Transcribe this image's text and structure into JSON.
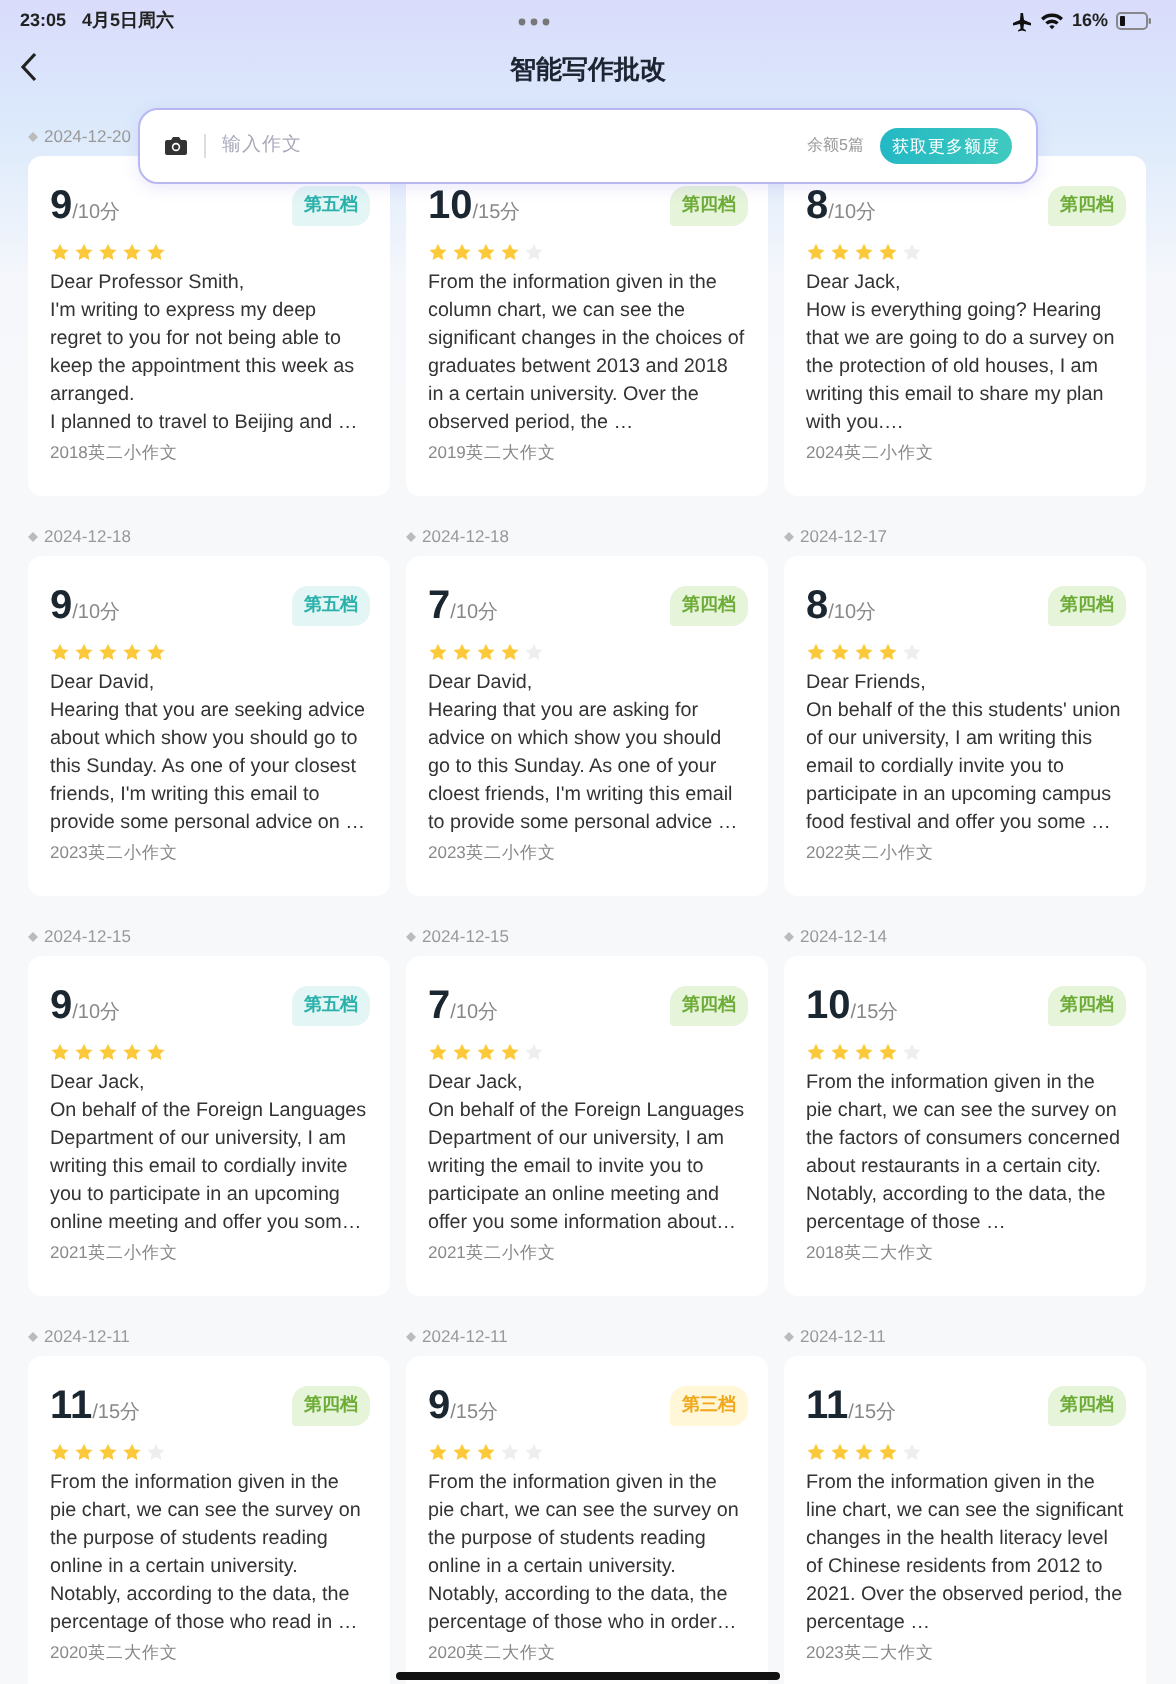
{
  "status_bar": {
    "time": "23:05",
    "date": "4月5日周六",
    "battery": "16%"
  },
  "header": {
    "title": "智能写作批改"
  },
  "composer": {
    "placeholder": "输入作文",
    "quota": "余额5篇",
    "action": "获取更多额度"
  },
  "essays": [
    {
      "date": "2024-12-20",
      "score": "9",
      "max": "/10分",
      "tier": "第五档",
      "kind": "five",
      "stars": 5,
      "excerpt": "Dear Professor Smith,\nI'm writing to express my deep regret to you for not being able to keep the appointment this week as arranged.\nI planned to travel to Beijing and …",
      "source": "2018英二小作文"
    },
    {
      "score": "10",
      "max": "/15分",
      "tier": "第四档",
      "kind": "four",
      "stars": 4,
      "excerpt": "From the information given in the column chart, we can see the significant changes in the choices of graduates betwent 2013 and 2018 in a certain university. Over the observed period, the …",
      "source": "2019英二大作文"
    },
    {
      "score": "8",
      "max": "/10分",
      "tier": "第四档",
      "kind": "four",
      "stars": 4,
      "excerpt": "Dear Jack,\nHow is everything going? Hearing that we are going to do a survey on the protection of old houses, I am writing this email to share my plan with you.…",
      "source": "2024英二小作文"
    },
    {
      "date": "2024-12-18",
      "score": "9",
      "max": "/10分",
      "tier": "第五档",
      "kind": "five",
      "stars": 5,
      "excerpt": "Dear David,\nHearing that you are seeking advice about which show you should go to this Sunday. As one of your closest friends, I'm writing this email to provide some personal advice on …",
      "source": "2023英二小作文"
    },
    {
      "date": "2024-12-18",
      "score": "7",
      "max": "/10分",
      "tier": "第四档",
      "kind": "four",
      "stars": 4,
      "excerpt": "Dear David,\nHearing that you are asking for advice on which show you should go to this Sunday. As one of your cloest friends, I'm writing this email to provide some personal advice …",
      "source": "2023英二小作文"
    },
    {
      "date": "2024-12-17",
      "score": "8",
      "max": "/10分",
      "tier": "第四档",
      "kind": "four",
      "stars": 4,
      "excerpt": "Dear Friends,\nOn behalf of the this students' union of our university, I am writing this email to cordially invite you to participate in an upcoming campus food festival and offer you some …",
      "source": "2022英二小作文"
    },
    {
      "date": "2024-12-15",
      "score": "9",
      "max": "/10分",
      "tier": "第五档",
      "kind": "five",
      "stars": 5,
      "excerpt": "Dear Jack,\nOn behalf of the Foreign Languages Department of our university, I am writing this email to cordially invite you to participate in an upcoming online meeting and offer you som…",
      "source": "2021英二小作文"
    },
    {
      "date": "2024-12-15",
      "score": "7",
      "max": "/10分",
      "tier": "第四档",
      "kind": "four",
      "stars": 4,
      "excerpt": "Dear Jack,\nOn behalf of the Foreign Languages Department of our university, I am writing the email to invite you to participate an online meeting and offer you some information about…",
      "source": "2021英二小作文"
    },
    {
      "date": "2024-12-14",
      "score": "10",
      "max": "/15分",
      "tier": "第四档",
      "kind": "four",
      "stars": 4,
      "excerpt": "From the information given in the pie chart, we can see the survey on the factors of consumers concerned about restaurants in a certain city. Notably, according to the data, the percentage of those …",
      "source": "2018英二大作文"
    },
    {
      "date": "2024-12-11",
      "score": "11",
      "max": "/15分",
      "tier": "第四档",
      "kind": "four",
      "stars": 4,
      "excerpt": "From the information given in the pie chart, we can see the survey on the purpose of students reading online in a certain university. Notably, according to the data, the percentage of those who read in …",
      "source": "2020英二大作文"
    },
    {
      "date": "2024-12-11",
      "score": "9",
      "max": "/15分",
      "tier": "第三档",
      "kind": "three",
      "stars": 3,
      "excerpt": "From the information given in the pie chart, we can see the survey on the purpose of students reading online in a certain university. Notably, according to the data, the percentage of those who in order…",
      "source": "2020英二大作文"
    },
    {
      "date": "2024-12-11",
      "score": "11",
      "max": "/15分",
      "tier": "第四档",
      "kind": "four",
      "stars": 4,
      "excerpt": "From the information given in the line chart, we can see the significant changes in the health literacy level of Chinese residents from 2012 to 2021. Over the observed period, the percentage …",
      "source": "2023英二大作文"
    }
  ]
}
